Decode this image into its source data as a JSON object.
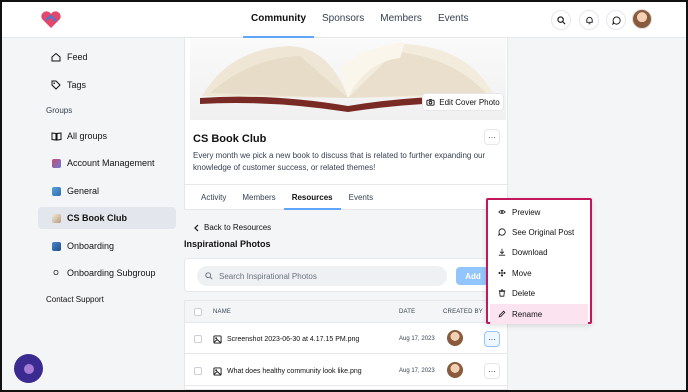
{
  "nav": {
    "tabs": [
      {
        "label": "Community",
        "active": true
      },
      {
        "label": "Sponsors",
        "active": false
      },
      {
        "label": "Members",
        "active": false
      },
      {
        "label": "Events",
        "active": false
      }
    ]
  },
  "sidebar": {
    "feed": "Feed",
    "tags": "Tags",
    "groups_heading": "Groups",
    "items": [
      {
        "label": "All groups",
        "icon": "book-icon"
      },
      {
        "label": "Account Management",
        "icon": "group-image-icon"
      },
      {
        "label": "General",
        "icon": "group-image-icon"
      },
      {
        "label": "CS Book Club",
        "icon": "group-image-icon",
        "active": true
      },
      {
        "label": "Onboarding",
        "icon": "group-image-icon"
      },
      {
        "label": "Onboarding Subgroup",
        "icon": "letter-o-icon"
      }
    ],
    "subgroup_badge": "O",
    "contact": "Contact Support"
  },
  "group": {
    "edit_cover": "Edit Cover Photo",
    "title": "CS Book Club",
    "more": "···",
    "description": "Every month we pick a new book to discuss that is related to further expanding our knowledge of customer success, or related themes!",
    "tabs": [
      {
        "label": "Activity",
        "active": false
      },
      {
        "label": "Members",
        "active": false
      },
      {
        "label": "Resources",
        "active": true
      },
      {
        "label": "Events",
        "active": false
      }
    ]
  },
  "resources": {
    "back": "Back to Resources",
    "folder_title": "Inspirational Photos",
    "search_placeholder": "Search Inspirational Photos",
    "add_label": "Add",
    "columns": {
      "name": "NAME",
      "date": "DATE",
      "created_by": "CREATED BY"
    },
    "rows": [
      {
        "name": "Screenshot 2023-06-30 at 4.17.15 PM.png",
        "date": "Aug 17, 2023"
      },
      {
        "name": "What does healthy community look like.png",
        "date": "Aug 17, 2023"
      }
    ]
  },
  "context_menu": {
    "items": [
      {
        "label": "Preview",
        "icon": "eye-icon"
      },
      {
        "label": "See Original Post",
        "icon": "comment-icon"
      },
      {
        "label": "Download",
        "icon": "download-icon"
      },
      {
        "label": "Move",
        "icon": "move-icon"
      },
      {
        "label": "Delete",
        "icon": "trash-icon"
      },
      {
        "label": "Rename",
        "icon": "pencil-icon"
      }
    ],
    "highlight_color": "#c2185b"
  },
  "colors": {
    "accent": "#60a5fa",
    "add_button": "#93c5fd",
    "fab": "#3b2a8f"
  }
}
